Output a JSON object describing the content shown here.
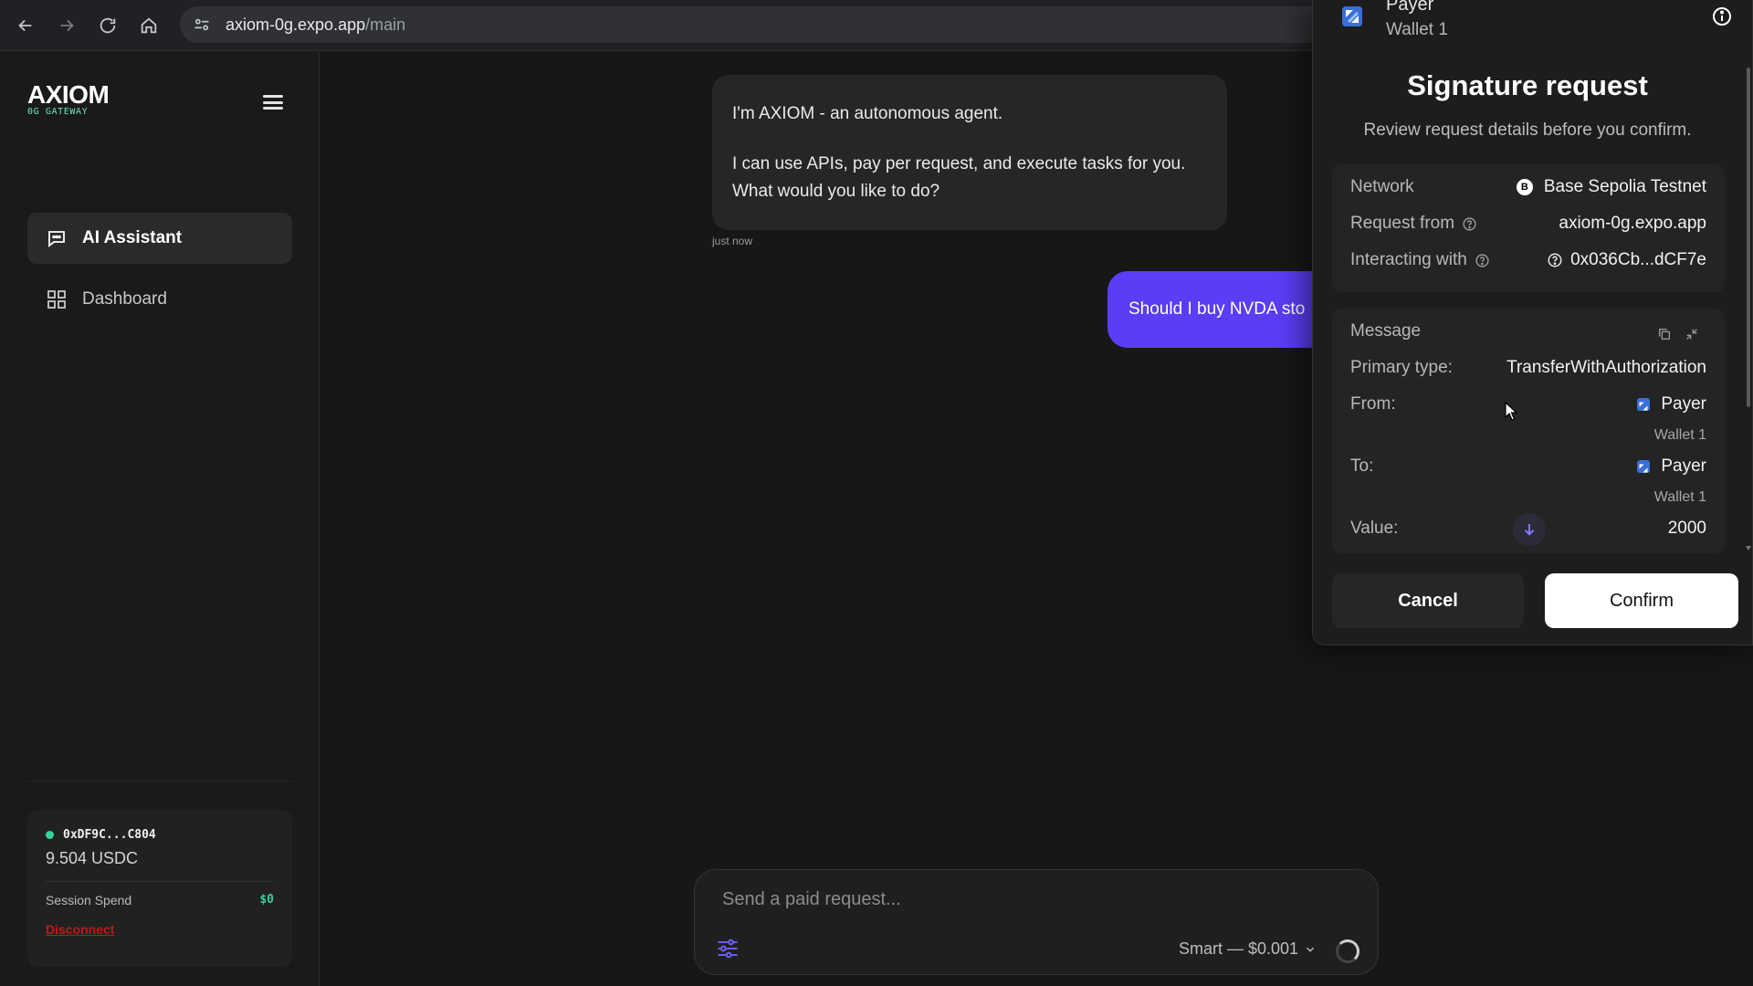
{
  "browser": {
    "url_host": "axiom-0g.expo.app",
    "url_path": "/main"
  },
  "sidebar": {
    "logo": "AXIOM",
    "logo_sub": "0G GATEWAY",
    "items": [
      {
        "label": "AI Assistant",
        "icon": "chat-icon",
        "active": true
      },
      {
        "label": "Dashboard",
        "icon": "grid-icon",
        "active": false
      }
    ],
    "wallet": {
      "address": "0xDF9C...C804",
      "balance": "9.504 USDC",
      "session_label": "Session Spend",
      "session_value": "$0",
      "disconnect": "Disconnect"
    }
  },
  "chat": {
    "assistant_line1": "I'm AXIOM - an autonomous agent.",
    "assistant_line2": "I can use APIs, pay per request, and execute tasks for you.",
    "assistant_line3": "What would you like to do?",
    "timestamp": "just now",
    "user_message": "Should I buy NVDA sto"
  },
  "composer": {
    "placeholder": "Send a paid request...",
    "model": "Smart — $0.001"
  },
  "popup": {
    "account_name": "Payer",
    "account_sub": "Wallet 1",
    "title": "Signature request",
    "subtitle": "Review request details before you confirm.",
    "network_label": "Network",
    "network_badge": "B",
    "network_value": "Base Sepolia Testnet",
    "request_from_label": "Request from",
    "request_from_value": "axiom-0g.expo.app",
    "interacting_label": "Interacting with",
    "interacting_value": "0x036Cb...dCF7e",
    "message_label": "Message",
    "primary_type_label": "Primary type:",
    "primary_type_value": "TransferWithAuthorization",
    "from_label": "From:",
    "from_name": "Payer",
    "from_sub": "Wallet 1",
    "to_label": "To:",
    "to_name": "Payer",
    "to_sub": "Wallet 1",
    "value_label": "Value:",
    "value_value": "2000",
    "cancel": "Cancel",
    "confirm": "Confirm"
  },
  "colors": {
    "accent": "#5b3df5",
    "success": "#34d399",
    "danger": "#b91c1c"
  }
}
